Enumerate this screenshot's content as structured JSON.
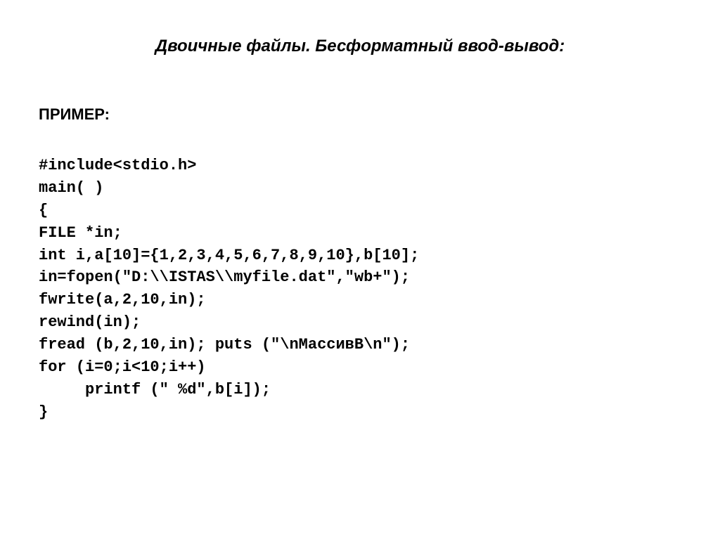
{
  "title": "Двоичные файлы. Бесформатный ввод-вывод:",
  "label": "ПРИМЕР:",
  "code": "#include<stdio.h>\nmain( )\n{\nFILE *in;\nint i,a[10]={1,2,3,4,5,6,7,8,9,10},b[10];\nin=fopen(\"D:\\\\ISTAS\\\\myfile.dat\",\"wb+\");\nfwrite(a,2,10,in);\nrewind(in);\nfread (b,2,10,in); puts (\"\\nМассивB\\n\");\nfor (i=0;i<10;i++)\n     printf (\" %d\",b[i]);\n}"
}
